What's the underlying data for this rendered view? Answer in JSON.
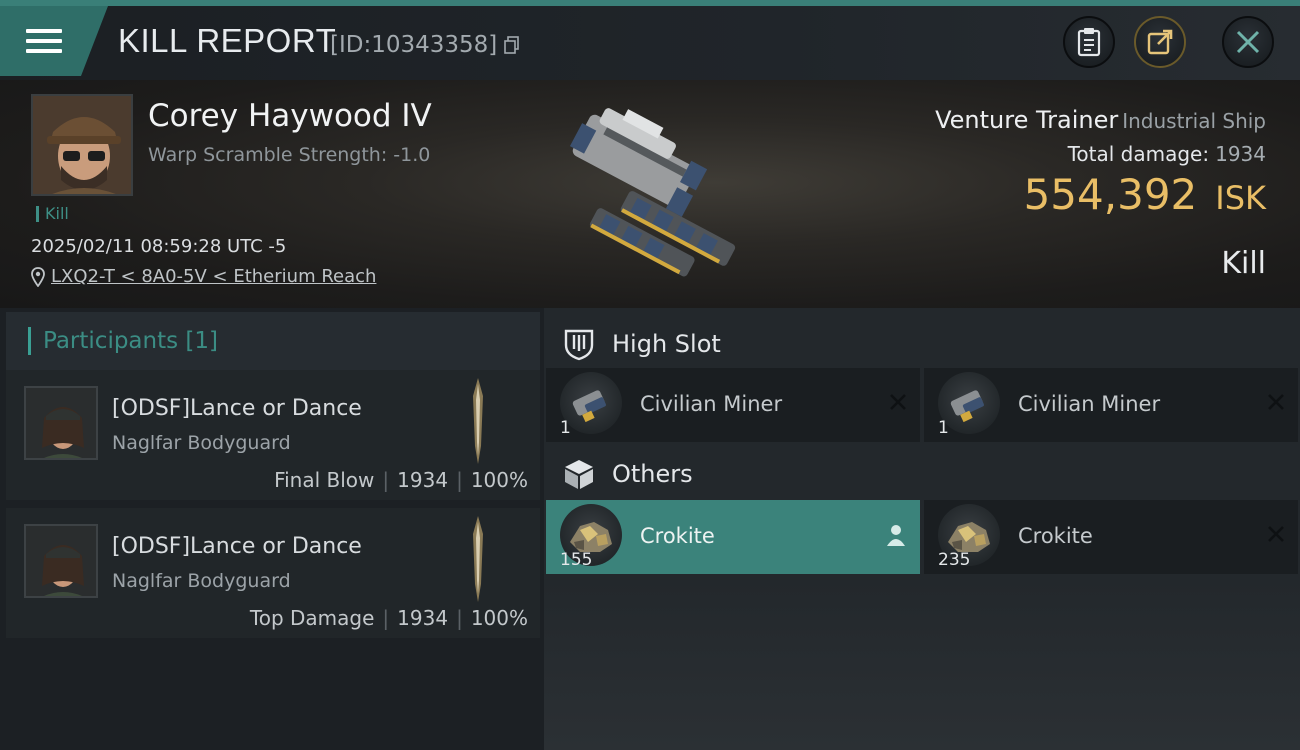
{
  "header": {
    "title": "KILL REPORT",
    "kill_id": "[ID:10343358]",
    "icons": {
      "menu": "hamburger-menu-icon",
      "copy": "copy-icon",
      "report": "clipboard-icon",
      "share": "share-icon",
      "close": "close-icon"
    }
  },
  "victim": {
    "name": "Corey Haywood IV",
    "warp_scramble": "Warp Scramble Strength: -1.0",
    "tag": "Kill",
    "timestamp": "2025/02/11 08:59:28 UTC -5",
    "location": "LXQ2-T < 8A0-5V < Etherium Reach"
  },
  "ship": {
    "name": "Venture Trainer",
    "class": "Industrial Ship",
    "total_damage_label": "Total damage:",
    "total_damage": "1934",
    "isk_value": "554,392",
    "isk_unit": "ISK",
    "result": "Kill"
  },
  "participants": {
    "header": "Participants [1]",
    "items": [
      {
        "name": "[ODSF]Lance or Dance",
        "ship": "Naglfar Bodyguard",
        "role": "Final Blow",
        "damage": "1934",
        "percent": "100%"
      },
      {
        "name": "[ODSF]Lance or Dance",
        "ship": "Naglfar Bodyguard",
        "role": "Top Damage",
        "damage": "1934",
        "percent": "100%"
      }
    ]
  },
  "high_slot": {
    "title": "High Slot",
    "items": [
      {
        "name": "Civilian Miner",
        "qty": "1"
      },
      {
        "name": "Civilian Miner",
        "qty": "1"
      }
    ]
  },
  "others": {
    "title": "Others",
    "items": [
      {
        "name": "Crokite",
        "qty": "155",
        "status": "dropped"
      },
      {
        "name": "Crokite",
        "qty": "235",
        "status": "destroyed"
      }
    ]
  },
  "colors": {
    "accent": "#3b837b",
    "isk": "#e9be66",
    "background": "#1c2024"
  }
}
